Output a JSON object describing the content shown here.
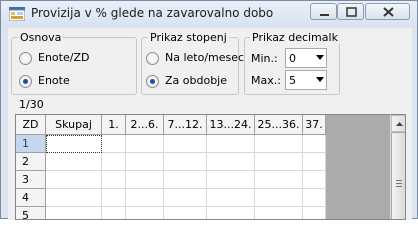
{
  "window": {
    "title": "Provizija v % glede na zavarovalno dobo"
  },
  "osnova": {
    "label": "Osnova",
    "options": [
      {
        "label": "Enote/ZD",
        "checked": false
      },
      {
        "label": "Enote",
        "checked": true
      }
    ]
  },
  "prikaz_stopenj": {
    "label": "Prikaz stopenj",
    "options": [
      {
        "label": "Na leto/mesec",
        "checked": false
      },
      {
        "label": "Za obdobje",
        "checked": true
      }
    ]
  },
  "prikaz_decimalk": {
    "label": "Prikaz decimalk",
    "min_label": "Min.:",
    "min_value": "0",
    "max_label": "Max.:",
    "max_value": "5"
  },
  "counter": "1/30",
  "grid": {
    "columns": [
      "ZD",
      "Skupaj",
      "1.",
      "2...6.",
      "7...12.",
      "13...24.",
      "25...36.",
      "37."
    ],
    "rows": [
      "1",
      "2",
      "3",
      "4",
      "5"
    ],
    "selected_row": 0
  },
  "colors": {
    "selected_row": "#c5d7ee",
    "radio_dot": "#1e4f9c",
    "grid_background": "#ababab"
  }
}
